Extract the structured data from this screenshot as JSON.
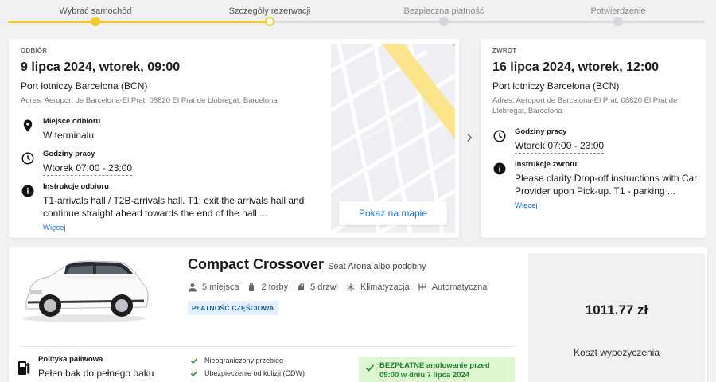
{
  "steps": [
    {
      "label": "Wybrać samochód",
      "state": "done"
    },
    {
      "label": "Szczegóły rezerwacji",
      "state": "current"
    },
    {
      "label": "Bezpieczna płatność",
      "state": "future"
    },
    {
      "label": "Potwierdzenie",
      "state": "future"
    }
  ],
  "pickup": {
    "eyebrow": "ODBIÓR",
    "datetime": "9 lipca 2024, wtorek, 09:00",
    "location": "Port lotniczy Barcelona (BCN)",
    "address": "Adres: Aeroport de Barcelona-El Prat, 08820 El Prat de Llobregat, Barcelona",
    "place_label": "Miejsce odbioru",
    "place_value": "W terminalu",
    "hours_label": "Godziny pracy",
    "hours_value": "Wtorek 07:00 - 23:00",
    "instructions_label": "Instrukcje odbioru",
    "instructions_value": "T1-arrivals hall / T2B-arrivals hall. T1: exit the arrivals hall and continue straight ahead towards the end of the hall ...",
    "more_link": "Więcej",
    "map_button": "Pokaż na mapie"
  },
  "dropoff": {
    "eyebrow": "ZWROT",
    "datetime": "16 lipca 2024, wtorek, 12:00",
    "location": "Port lotniczy Barcelona (BCN)",
    "address": "Adres: Aeroport de Barcelona-El Prat, 08820 El Prat de Llobregat, Barcelona",
    "hours_label": "Godziny pracy",
    "hours_value": "Wtorek 07:00 - 23:00",
    "instructions_label": "Instrukcje zwrotu",
    "instructions_value": "Please clarify Drop-off instructions with Car Provider upon Pick-up. T1 - parking ...",
    "more_link": "Więcej"
  },
  "car": {
    "category": "Compact Crossover",
    "model": "Seat Arona albo podobny",
    "specs": {
      "seats": "5 miejsca",
      "bags": "2 torby",
      "doors": "5 drzwi",
      "ac": "Klimatyzacja",
      "transmission": "Automatyczna"
    },
    "badge": "PŁATNOŚĆ CZĘŚCIOWA",
    "fuel_label": "Polityka paliwowa",
    "fuel_value": "Pełen bak do pełnego baku",
    "features": [
      "Nieograniczony przebieg",
      "Ubezpieczenie od kolizji (CDW)"
    ],
    "free_cancel": "BEZPŁATNE anulowanie przed 09:00 w dniu 7 lipca 2024"
  },
  "price": {
    "amount": "1011.77 zł",
    "label": "Koszt wypożyczenia"
  },
  "colors": {
    "accent_yellow": "#f5cb2c",
    "link_blue": "#1a73e8",
    "success_green": "#1d8a2a"
  }
}
